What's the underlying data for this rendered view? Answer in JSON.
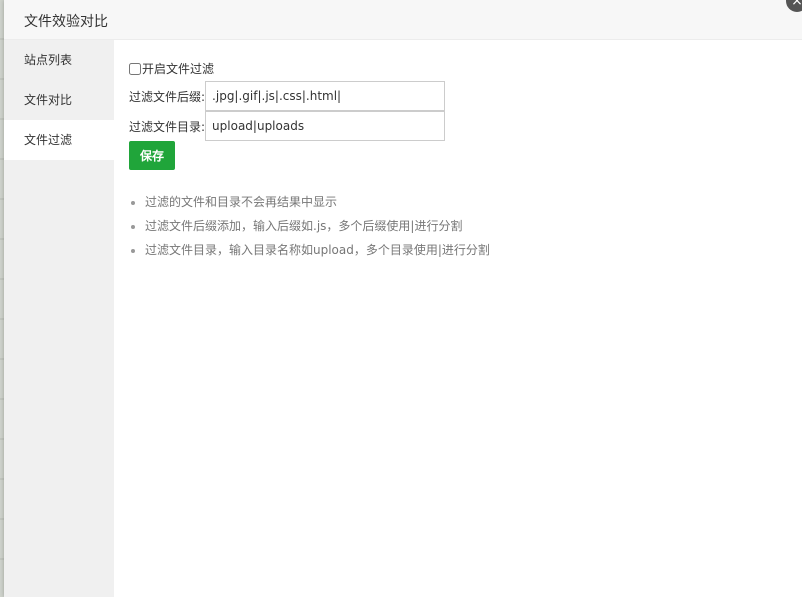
{
  "dialog": {
    "title": "文件效验对比",
    "close_glyph": "×"
  },
  "sidebar": {
    "items": [
      {
        "label": "站点列表",
        "active": false
      },
      {
        "label": "文件对比",
        "active": false
      },
      {
        "label": "文件过滤",
        "active": true
      }
    ]
  },
  "filter": {
    "enable_label": "开启文件过滤",
    "enabled": false,
    "suffix_label": "过滤文件后缀:",
    "suffix_value": ".jpg|.gif|.js|.css|.html|",
    "dir_label": "过滤文件目录:",
    "dir_value": "upload|uploads",
    "save_label": "保存"
  },
  "help": [
    "过滤的文件和目录不会再结果中显示",
    "过滤文件后缀添加，输入后缀如.js，多个后缀使用|进行分割",
    "过滤文件目录，输入目录名称如upload，多个目录使用|进行分割"
  ],
  "colors": {
    "accent": "#20a53a",
    "sidebar_bg": "#f0f0f0",
    "header_bg": "#f7f7f7"
  }
}
